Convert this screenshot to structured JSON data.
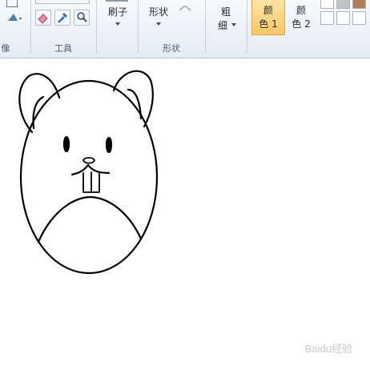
{
  "ribbon": {
    "groups": {
      "image_label": "像",
      "tools_label": "工具",
      "shapes_label": "形状"
    },
    "buttons": {
      "brushes_label": "刷子",
      "shapes_label": "形状",
      "size_label_top": "粗",
      "size_label_bottom": "细",
      "color1_top": "颜",
      "color1_bottom": "色 1",
      "color2_top": "颜",
      "color2_bottom": "色 2"
    },
    "tool_icons": [
      "pencil-icon",
      "eraser-icon",
      "color-picker-icon",
      "magnifier-icon"
    ],
    "palette_colors": [
      "#ffffff",
      "#c3c3c3",
      "#b97a57",
      "#ffffff",
      "#ffffff",
      "#ffffff"
    ],
    "accent_color": "#fbc761"
  },
  "canvas": {
    "drawing": "hamster-drawing"
  },
  "watermark": {
    "text": "Baidu经验"
  }
}
